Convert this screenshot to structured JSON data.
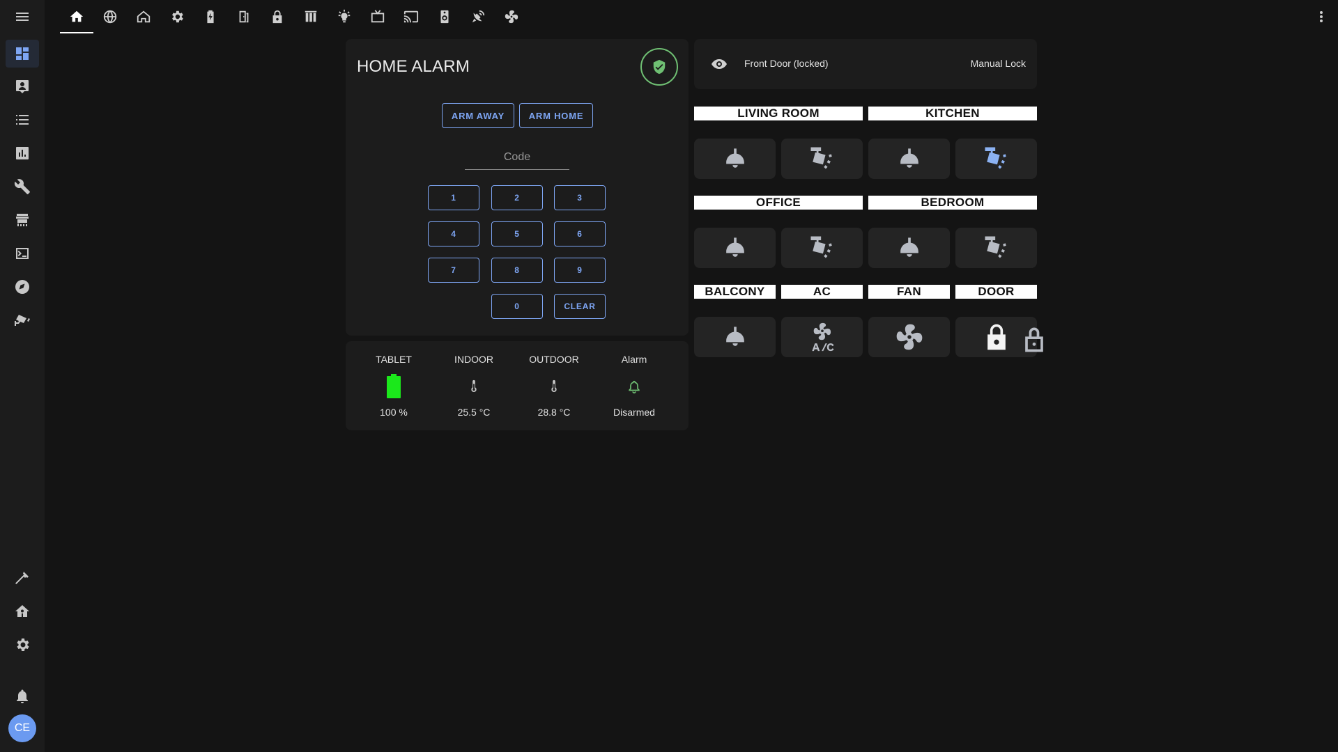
{
  "colors": {
    "background": "#141414",
    "card": "#1c1c1c",
    "accent": "#7ea6f4",
    "armed_ok": "#6fbf73",
    "battery": "#1be81b",
    "light_on": "#8cb2f2"
  },
  "sidebar": {
    "items": [
      {
        "icon": "dashboard-icon",
        "active": true
      },
      {
        "icon": "account-box-icon",
        "active": false
      },
      {
        "icon": "list-icon",
        "active": false
      },
      {
        "icon": "chart-box-icon",
        "active": false
      },
      {
        "icon": "wrench-icon",
        "active": false
      },
      {
        "icon": "hacs-store-icon",
        "active": false
      },
      {
        "icon": "terminal-icon",
        "active": false
      },
      {
        "icon": "compass-icon",
        "active": false
      },
      {
        "icon": "cctv-icon",
        "active": false
      }
    ],
    "bottom_items": [
      {
        "icon": "hammer-icon"
      },
      {
        "icon": "home-gear-icon"
      },
      {
        "icon": "gear-icon"
      },
      {
        "icon": "bell-icon"
      }
    ],
    "avatar_initials": "CE"
  },
  "top_tabs": [
    {
      "icon": "home-icon",
      "active": true
    },
    {
      "icon": "globe-icon"
    },
    {
      "icon": "home-outline-icon"
    },
    {
      "icon": "gear-icon"
    },
    {
      "icon": "battery-charging-icon"
    },
    {
      "icon": "door-icon"
    },
    {
      "icon": "lock-icon"
    },
    {
      "icon": "blinds-icon"
    },
    {
      "icon": "lightbulb-icon"
    },
    {
      "icon": "tv-icon"
    },
    {
      "icon": "cast-icon"
    },
    {
      "icon": "speaker-icon"
    },
    {
      "icon": "satellite-icon"
    },
    {
      "icon": "fan-icon"
    }
  ],
  "alarm": {
    "title": "HOME ALARM",
    "state_icon": "shield-check-icon",
    "arm_away": "ARM AWAY",
    "arm_home": "ARM HOME",
    "code_placeholder": "Code",
    "keys": [
      "1",
      "2",
      "3",
      "4",
      "5",
      "6",
      "7",
      "8",
      "9",
      "0",
      "CLEAR"
    ]
  },
  "sensors": [
    {
      "name": "TABLET",
      "icon": "battery-icon",
      "value": "100 %",
      "level": 1.0
    },
    {
      "name": "INDOOR",
      "icon": "thermometer-icon",
      "value": "25.5 °C"
    },
    {
      "name": "OUTDOOR",
      "icon": "thermometer-icon",
      "value": "28.8 °C"
    },
    {
      "name": "Alarm",
      "icon": "bell-outline-icon",
      "value": "Disarmed"
    }
  ],
  "door": {
    "name": "Front Door (locked)",
    "state": "Manual Lock",
    "icon": "eye-icon"
  },
  "rooms": {
    "living_room": "LIVING ROOM",
    "kitchen": "KITCHEN",
    "office": "OFFICE",
    "bedroom": "BEDROOM",
    "balcony": "BALCONY",
    "ac": "AC",
    "fan": "FAN",
    "door": "DOOR"
  },
  "tiles": [
    {
      "icon": "ceiling-light-icon",
      "on": false
    },
    {
      "icon": "spotlight-icon",
      "on": false
    },
    {
      "icon": "ceiling-light-icon",
      "on": false
    },
    {
      "icon": "spotlight-icon",
      "on": true
    },
    {
      "icon": "ceiling-light-icon",
      "on": false
    },
    {
      "icon": "spotlight-icon",
      "on": false
    },
    {
      "icon": "ceiling-light-icon",
      "on": false
    },
    {
      "icon": "spotlight-icon",
      "on": false
    },
    {
      "icon": "ceiling-light-icon",
      "on": false
    },
    {
      "icon": "air-conditioner-icon",
      "on": false
    },
    {
      "icon": "fan-icon",
      "on": false
    },
    {
      "icon": "lock-icon",
      "on": false
    }
  ]
}
